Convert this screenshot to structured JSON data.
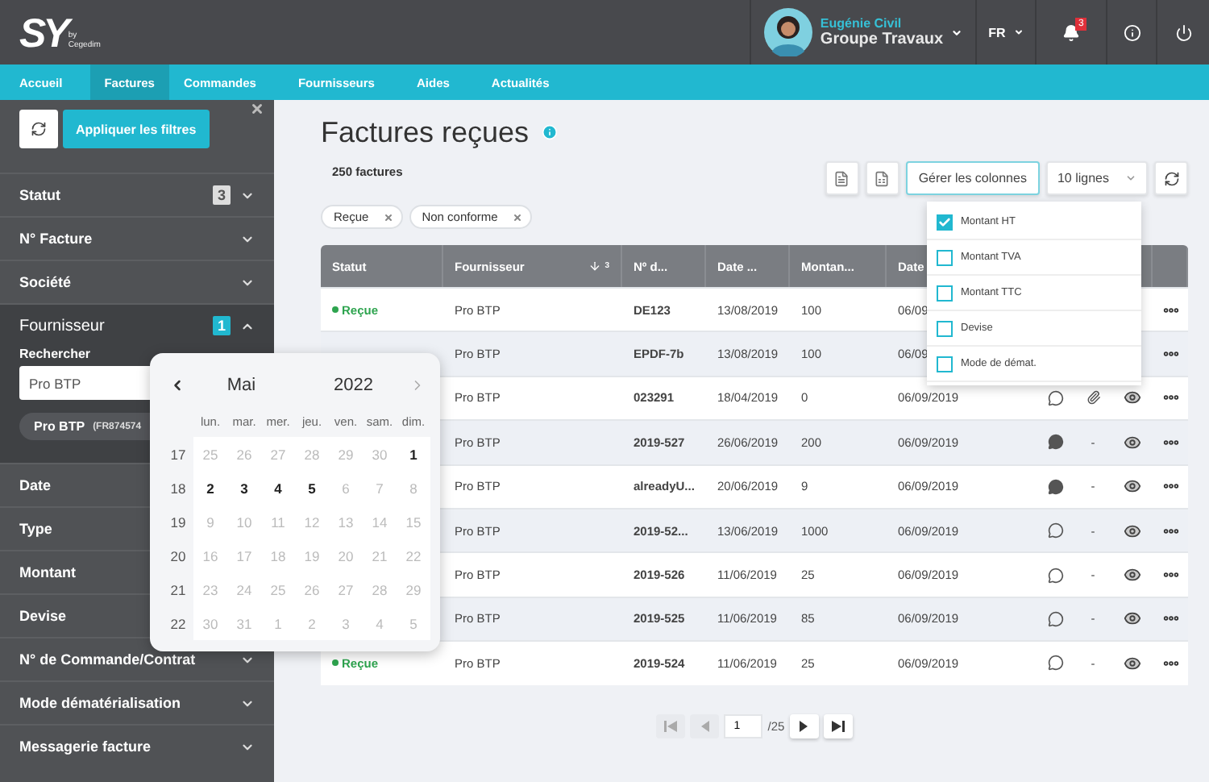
{
  "logo": {
    "mark": "SY",
    "by": "by",
    "brand": "Cegedim"
  },
  "user": {
    "name": "Eugénie Civil",
    "group": "Groupe Travaux"
  },
  "language": "FR",
  "notifications": "3",
  "nav": [
    {
      "label": "Accueil",
      "selected": false
    },
    {
      "label": "Factures",
      "selected": true
    },
    {
      "label": "Commandes",
      "selected": false
    },
    {
      "label": "Fournisseurs",
      "selected": false
    },
    {
      "label": "Aides",
      "selected": false
    },
    {
      "label": "Actualités",
      "selected": false
    }
  ],
  "sidebar": {
    "apply_button": "Appliquer les filtres",
    "filters": [
      {
        "label": "Statut",
        "badge": "3",
        "expanded": false
      },
      {
        "label": "N° Facture",
        "expanded": false
      },
      {
        "label": "Société",
        "expanded": false
      },
      {
        "label": "Fournisseur",
        "badge": "1",
        "expanded": true,
        "search_label": "Rechercher",
        "search_value": "Pro BTP",
        "chip": {
          "name": "Pro BTP",
          "code": "(FR874574"
        }
      },
      {
        "label": "Date"
      },
      {
        "label": "Type"
      },
      {
        "label": "Montant"
      },
      {
        "label": "Devise"
      },
      {
        "label": "N° de Commande/Contrat",
        "expanded": false
      },
      {
        "label": "Mode dématérialisation",
        "expanded": false
      },
      {
        "label": "Messagerie facture",
        "expanded": false
      }
    ]
  },
  "page": {
    "title": "Factures reçues",
    "count": "250 factures",
    "columns_button": "Gérer les colonnes",
    "rows_select": "10 lignes",
    "active_filters": [
      {
        "label": "Reçue"
      },
      {
        "label": "Non conforme"
      }
    ]
  },
  "column_menu": [
    {
      "label": "Montant HT",
      "checked": true
    },
    {
      "label": "Montant TVA",
      "checked": false
    },
    {
      "label": "Montant TTC",
      "checked": false
    },
    {
      "label": "Devise",
      "checked": false
    },
    {
      "label": "Mode de démat.",
      "checked": false
    }
  ],
  "table": {
    "columns": [
      {
        "label": "Statut"
      },
      {
        "label": "Fournisseur",
        "sort_rank": "3"
      },
      {
        "label": "Nº d..."
      },
      {
        "label": "Date ..."
      },
      {
        "label": "Montan..."
      },
      {
        "label": "Date"
      }
    ],
    "rows": [
      {
        "status": {
          "kind": "received",
          "text": "Reçue"
        },
        "supplier": "Pro BTP",
        "number": "DE123",
        "date": "13/08/2019",
        "amount": "100",
        "date_2": "06/09"
      },
      {
        "supplier": "Pro BTP",
        "number": "EPDF-7b",
        "date": "13/08/2019",
        "amount": "100",
        "date_2": "06/09"
      },
      {
        "supplier": "Pro BTP",
        "number": "023291",
        "date": "18/04/2019",
        "amount": "0",
        "date_2": "06/09/2019",
        "has_comments": false,
        "attachment": {
          "kind": "icon"
        }
      },
      {
        "supplier": "Pro BTP",
        "number": "2019-527",
        "date": "26/06/2019",
        "amount": "200",
        "date_2": "06/09/2019",
        "has_comments": true,
        "attachment": {
          "kind": "text",
          "text": "-"
        }
      },
      {
        "supplier": "Pro BTP",
        "number": "alreadyU...",
        "date": "20/06/2019",
        "amount": "9",
        "date_2": "06/09/2019",
        "has_comments": true,
        "attachment": {
          "kind": "text",
          "text": "-"
        }
      },
      {
        "supplier": "Pro BTP",
        "number": "2019-52...",
        "date": "13/06/2019",
        "amount": "1000",
        "date_2": "06/09/2019",
        "has_comments": false,
        "attachment": {
          "kind": "text",
          "text": "-"
        }
      },
      {
        "supplier": "Pro BTP",
        "number": "2019-526",
        "date": "11/06/2019",
        "amount": "25",
        "date_2": "06/09/2019",
        "has_comments": false,
        "attachment": {
          "kind": "text",
          "text": "-"
        }
      },
      {
        "supplier": "Pro BTP",
        "number": "2019-525",
        "date": "11/06/2019",
        "amount": "85",
        "date_2": "06/09/2019",
        "has_comments": false,
        "attachment": {
          "kind": "text",
          "text": "-"
        }
      },
      {
        "status": {
          "kind": "received",
          "text": "Reçue"
        },
        "supplier": "Pro BTP",
        "number": "2019-524",
        "date": "11/06/2019",
        "amount": "25",
        "date_2": "06/09/2019",
        "has_comments": false,
        "attachment": {
          "kind": "text",
          "text": "-"
        }
      }
    ]
  },
  "pagination": {
    "first_disabled": true,
    "prev_disabled": true,
    "next_disabled": false,
    "last_disabled": false,
    "page": "1",
    "total": "/25"
  },
  "calendar": {
    "month": "Mai",
    "year": "2022",
    "next_disabled": true,
    "weekdays": [
      "lun.",
      "mar.",
      "mer.",
      "jeu.",
      "ven.",
      "sam.",
      "dim."
    ],
    "weeks": [
      {
        "number": "17",
        "days": [
          {
            "d": "25",
            "muted": true
          },
          {
            "d": "26",
            "muted": true
          },
          {
            "d": "27",
            "muted": true
          },
          {
            "d": "28",
            "muted": true
          },
          {
            "d": "29",
            "muted": true
          },
          {
            "d": "30",
            "muted": true
          },
          {
            "d": "1",
            "muted": false
          }
        ]
      },
      {
        "number": "18",
        "days": [
          {
            "d": "2",
            "muted": false
          },
          {
            "d": "3",
            "muted": false
          },
          {
            "d": "4",
            "muted": false
          },
          {
            "d": "5",
            "muted": false
          },
          {
            "d": "6",
            "muted": true
          },
          {
            "d": "7",
            "muted": true
          },
          {
            "d": "8",
            "muted": true
          }
        ]
      },
      {
        "number": "19",
        "days": [
          {
            "d": "9",
            "muted": true
          },
          {
            "d": "10",
            "muted": true
          },
          {
            "d": "11",
            "muted": true
          },
          {
            "d": "12",
            "muted": true
          },
          {
            "d": "13",
            "muted": true
          },
          {
            "d": "14",
            "muted": true
          },
          {
            "d": "15",
            "muted": true
          }
        ]
      },
      {
        "number": "20",
        "days": [
          {
            "d": "16",
            "muted": true
          },
          {
            "d": "17",
            "muted": true
          },
          {
            "d": "18",
            "muted": true
          },
          {
            "d": "19",
            "muted": true
          },
          {
            "d": "20",
            "muted": true
          },
          {
            "d": "21",
            "muted": true
          },
          {
            "d": "22",
            "muted": true
          }
        ]
      },
      {
        "number": "21",
        "days": [
          {
            "d": "23",
            "muted": true
          },
          {
            "d": "24",
            "muted": true
          },
          {
            "d": "25",
            "muted": true
          },
          {
            "d": "26",
            "muted": true
          },
          {
            "d": "27",
            "muted": true
          },
          {
            "d": "28",
            "muted": true
          },
          {
            "d": "29",
            "muted": true
          }
        ]
      },
      {
        "number": "22",
        "days": [
          {
            "d": "30",
            "muted": true
          },
          {
            "d": "31",
            "muted": true
          },
          {
            "d": "1",
            "muted": true
          },
          {
            "d": "2",
            "muted": true
          },
          {
            "d": "3",
            "muted": true
          },
          {
            "d": "4",
            "muted": true
          },
          {
            "d": "5",
            "muted": true
          }
        ]
      }
    ]
  }
}
